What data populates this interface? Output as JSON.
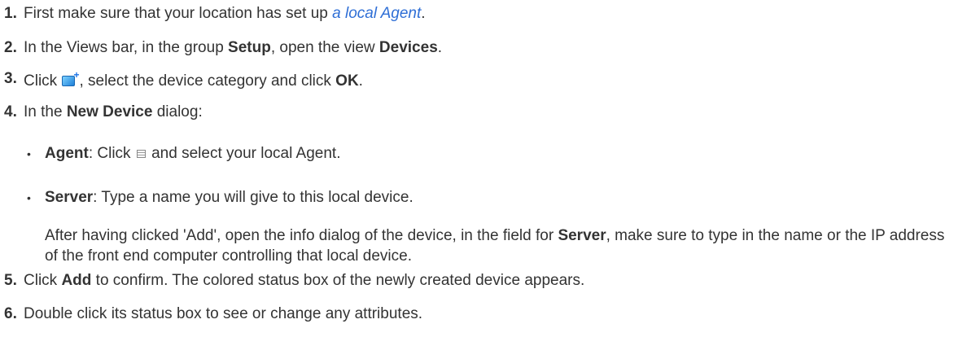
{
  "steps": [
    {
      "number": "1.",
      "prefix": "First make sure that your location has set up ",
      "link": "a local Agent",
      "suffix": "."
    },
    {
      "number": "2.",
      "t1": "In the Views bar, in the group ",
      "b1": "Setup",
      "t2": ", open the view ",
      "b2": "Devices",
      "t3": "."
    },
    {
      "number": "3.",
      "t1": "Click ",
      "t2": ", select the device category and click ",
      "b1": "OK",
      "t3": "."
    },
    {
      "number": "4.",
      "t1": "In the ",
      "b1": "New Device",
      "t2": " dialog:"
    },
    {
      "number": "5.",
      "t1": "Click ",
      "b1": "Add",
      "t2": " to confirm. The colored status box of the newly created device appears."
    },
    {
      "number": "6.",
      "t1": "Double click its status box to see or change any attributes."
    }
  ],
  "bullets": [
    {
      "b1": "Agent",
      "t1": ": Click ",
      "t2": " and select your local Agent."
    },
    {
      "b1": "Server",
      "t1": ": Type a name you will give to this local device."
    }
  ],
  "server_note": {
    "t1": "After having clicked 'Add', open the info dialog of the device, in the field for ",
    "b1": "Server",
    "t2": ", make sure to type in the name or the IP address of the front end computer controlling that local device."
  },
  "icons": {
    "step3": "add-device-icon",
    "agent": "list-icon"
  },
  "colors": {
    "link": "#2f6fd6",
    "text": "#333333"
  }
}
